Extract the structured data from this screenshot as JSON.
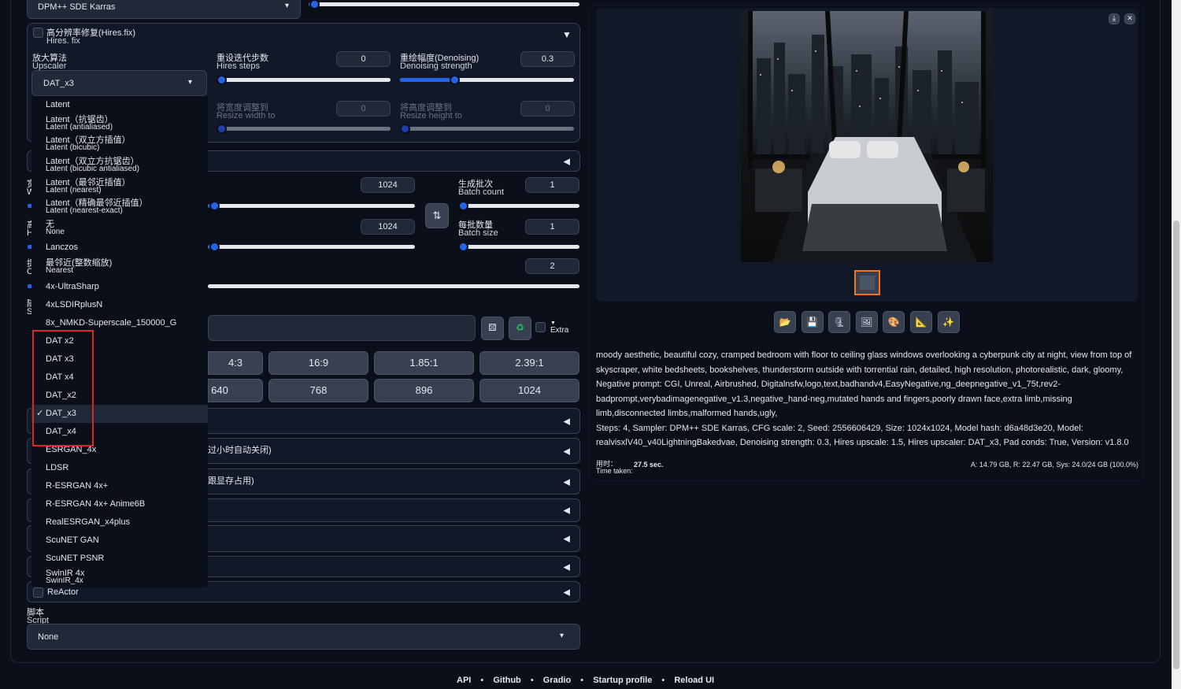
{
  "sampler": {
    "value": "DPM++ SDE Karras"
  },
  "hires": {
    "title_cn": "高分辨率修复(Hires.fix)",
    "title_en": "Hires. fix",
    "toggle": "▼",
    "upscaler_cn": "放大算法",
    "upscaler_en": "Upscaler",
    "upscaler_value": "DAT_x3",
    "steps_cn": "重设迭代步数",
    "steps_en": "Hires steps",
    "steps_value": "0",
    "steps_fraction": 0.0,
    "denoise_cn": "重绘幅度(Denoising)",
    "denoise_en": "Denoising strength",
    "denoise_value": "0.3",
    "denoise_fraction": 0.3,
    "resize_w_cn": "将宽度调整到",
    "resize_w_en": "Resize width to",
    "resize_w_value": "0",
    "resize_h_cn": "将高度调整到",
    "resize_h_en": "Resize height to",
    "resize_h_value": "0"
  },
  "dropdown": {
    "options": [
      {
        "label": "Latent",
        "sub": ""
      },
      {
        "label": "Latent（抗锯齿）",
        "sub": "Latent (antialiased)"
      },
      {
        "label": "Latent（双立方插值）",
        "sub": "Latent (bicubic)"
      },
      {
        "label": "Latent（双立方抗锯齿）",
        "sub": "Latent (bicubic antialiased)"
      },
      {
        "label": "Latent（最邻近插值）",
        "sub": "Latent (nearest)"
      },
      {
        "label": "Latent（精确最邻近插值）",
        "sub": "Latent (nearest-exact)"
      },
      {
        "label": "无",
        "sub": "None"
      },
      {
        "label": "Lanczos",
        "sub": ""
      },
      {
        "label": "最邻近(整数缩放)",
        "sub": "Nearest"
      },
      {
        "label": "4x-UltraSharp",
        "sub": ""
      },
      {
        "label": "4xLSDIRplusN",
        "sub": ""
      },
      {
        "label": "8x_NMKD-Superscale_150000_G",
        "sub": ""
      },
      {
        "label": "DAT x2",
        "sub": ""
      },
      {
        "label": "DAT x3",
        "sub": ""
      },
      {
        "label": "DAT x4",
        "sub": ""
      },
      {
        "label": "DAT_x2",
        "sub": ""
      },
      {
        "label": "DAT_x3",
        "sub": ""
      },
      {
        "label": "DAT_x4",
        "sub": ""
      },
      {
        "label": "ESRGAN_4x",
        "sub": ""
      },
      {
        "label": "LDSR",
        "sub": ""
      },
      {
        "label": "R-ESRGAN 4x+",
        "sub": ""
      },
      {
        "label": "R-ESRGAN 4x+ Anime6B",
        "sub": ""
      },
      {
        "label": "RealESRGAN_x4plus",
        "sub": ""
      },
      {
        "label": "ScuNET GAN",
        "sub": ""
      },
      {
        "label": "ScuNET PSNR",
        "sub": ""
      },
      {
        "label": "SwinIR 4x",
        "sub": "SwinIR_4x"
      }
    ],
    "selected": "DAT_x3",
    "check": "✓"
  },
  "left_labels": {
    "l1": "宽",
    "l1b": "W",
    "l2": "高",
    "l2b": "H",
    "l3": "提",
    "l3b": "CI",
    "l4": "随",
    "l4b": "Se"
  },
  "size": {
    "width_value": "1024",
    "height_value": "1024",
    "swap_icon": "⇅"
  },
  "batch": {
    "count_cn": "生成批次",
    "count_en": "Batch count",
    "count_value": "1",
    "size_cn": "每批数量",
    "size_en": "Batch size",
    "size_value": "1",
    "cfg_value": "2"
  },
  "seed": {
    "dice_icon": "⚄",
    "recycle_icon": "♻",
    "extra_label": "Extra",
    "extra_arrow": "▼"
  },
  "ratios": [
    "4:3",
    "16:9",
    "1.85:1",
    "2.39:1"
  ],
  "sizes": [
    "640",
    "768",
    "896",
    "1024"
  ],
  "accordions": [
    "过小时自动关闭)",
    "跟显存占用)",
    "",
    "",
    "",
    ""
  ],
  "reactor": {
    "label": "ReActor"
  },
  "script": {
    "label_cn": "脚本",
    "label_en": "Script",
    "value": "None"
  },
  "output": {
    "download_icon": "⤓",
    "close_icon": "✕",
    "tools": [
      "📂",
      "💾",
      "🗜",
      "🖼",
      "🎨",
      "📐",
      "✨"
    ],
    "prompt": "moody aesthetic, beautiful cozy, cramped bedroom with floor to ceiling glass windows overlooking a cyberpunk city at night, view from top of skyscraper, white bedsheets, bookshelves, thunderstorm outside with torrential rain, detailed, high resolution, photorealistic, dark, gloomy,",
    "negative": "Negative prompt: CGI, Unreal, Airbrushed, Digitalnsfw,logo,text,badhandv4,EasyNegative,ng_deepnegative_v1_75t,rev2-badprompt,verybadimagenegative_v1.3,negative_hand-neg,mutated hands and fingers,poorly drawn face,extra limb,missing limb,disconnected limbs,malformed hands,ugly,",
    "params": "Steps: 4, Sampler: DPM++ SDE Karras, CFG scale: 2, Seed: 2556606429, Size: 1024x1024, Model hash: d6a48d3e20, Model: realvisxlV40_v40LightningBakedvae, Denoising strength: 0.3, Hires upscale: 1.5, Hires upscaler: DAT_x3, Pad conds: True, Version: v1.8.0",
    "time_cn": "用时：",
    "time_en": "Time taken:",
    "time_value": "27.5 sec.",
    "mem": "A: 14.79 GB, R: 22.47 GB, Sys: 24.0/24 GB (100.0%)"
  },
  "footer": {
    "links": [
      "API",
      "Github",
      "Gradio",
      "Startup profile",
      "Reload UI"
    ],
    "sep": "•"
  },
  "colors": {
    "accent": "#2563eb",
    "highlight_box": "#dc2626",
    "thumb_border": "#f97316"
  }
}
